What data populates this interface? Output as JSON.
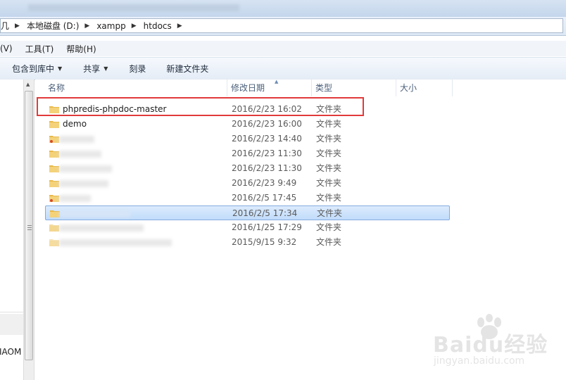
{
  "address_bar": {
    "crumbs": [
      "几",
      "本地磁盘 (D:)",
      "xampp",
      "htdocs"
    ]
  },
  "menubar": {
    "items": [
      "(V)",
      "工具(T)",
      "帮助(H)"
    ]
  },
  "toolbar": {
    "include_library": "包含到库中",
    "share": "共享",
    "burn": "刻录",
    "new_folder": "新建文件夹"
  },
  "columns": {
    "name": "名称",
    "modified": "修改日期",
    "type": "类型",
    "size": "大小"
  },
  "files": [
    {
      "name": "phpredis-phpdoc-master",
      "date": "2016/2/23 16:02",
      "type": "文件夹"
    },
    {
      "name": "demo",
      "date": "2016/2/23 16:00",
      "type": "文件夹"
    },
    {
      "name": "",
      "date": "2016/2/23 14:40",
      "type": "文件夹"
    },
    {
      "name": "",
      "date": "2016/2/23 11:30",
      "type": "文件夹"
    },
    {
      "name": "",
      "date": "2016/2/23 11:30",
      "type": "文件夹"
    },
    {
      "name": "",
      "date": "2016/2/23 9:49",
      "type": "文件夹"
    },
    {
      "name": "",
      "date": "2016/2/5 17:45",
      "type": "文件夹"
    },
    {
      "name": "",
      "date": "2016/2/5 17:34",
      "type": "文件夹"
    },
    {
      "name": "",
      "date": "2016/1/25 17:29",
      "type": "文件夹"
    },
    {
      "name": "",
      "date": "2015/9/15 9:32",
      "type": "文件夹"
    }
  ],
  "nav_pane": {
    "label": "IAOM"
  },
  "watermark": {
    "main": "Baidu经验",
    "sub": "jingyan.baidu.com"
  }
}
